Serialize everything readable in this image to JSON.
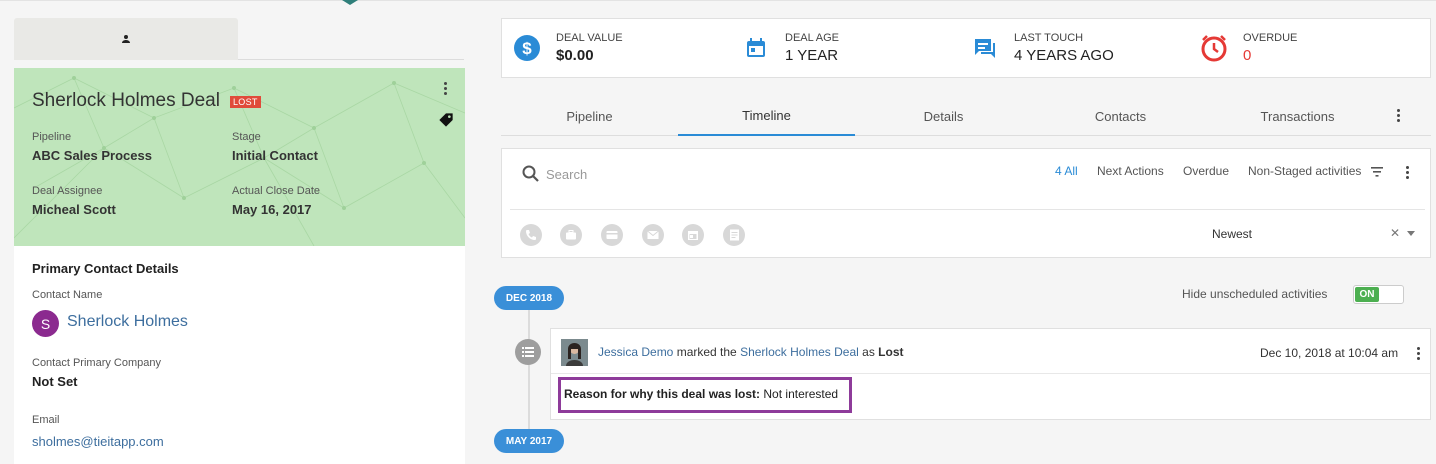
{
  "left_panel": {
    "deal": {
      "title": "Sherlock Holmes Deal",
      "status_badge": "LOST",
      "fields": [
        {
          "label": "Pipeline",
          "value": "ABC Sales Process"
        },
        {
          "label": "Stage",
          "value": "Initial Contact"
        },
        {
          "label": "Deal Assignee",
          "value": "Micheal Scott"
        },
        {
          "label": "Actual Close Date",
          "value": "May 16, 2017"
        }
      ]
    },
    "contact": {
      "section_title": "Primary Contact Details",
      "name_label": "Contact Name",
      "avatar_letter": "S",
      "name": "Sherlock Holmes",
      "company_label": "Contact Primary Company",
      "company": "Not Set",
      "email_label": "Email",
      "email": "sholmes@tieitapp.com"
    }
  },
  "stats": [
    {
      "label": "DEAL VALUE",
      "value": "$0.00",
      "icon": "dollar-icon",
      "color": "#2a8bd6"
    },
    {
      "label": "DEAL AGE",
      "value": "1 YEAR",
      "icon": "calendar-icon",
      "color": "#2a8bd6"
    },
    {
      "label": "LAST TOUCH",
      "value": "4 YEARS AGO",
      "icon": "chat-icon",
      "color": "#2a8bd6"
    },
    {
      "label": "OVERDUE",
      "value": "0",
      "icon": "alarm-icon",
      "color": "#e53935"
    }
  ],
  "tabs": [
    "Pipeline",
    "Timeline",
    "Details",
    "Contacts",
    "Transactions"
  ],
  "active_tab": "Timeline",
  "filters": {
    "search_placeholder": "Search",
    "options": [
      "4 All",
      "Next Actions",
      "Overdue",
      "Non-Staged activities"
    ],
    "active": "4 All",
    "activity_icons": [
      "phone-icon",
      "briefcase-icon",
      "card-icon",
      "mail-icon",
      "calendar-icon",
      "note-icon"
    ],
    "sort": "Newest"
  },
  "timeline": {
    "hide_label": "Hide unscheduled activities",
    "toggle_state": "ON",
    "groups": [
      "DEC 2018",
      "MAY 2017"
    ],
    "entry": {
      "user": "Jessica Demo",
      "action": "marked the",
      "deal": "Sherlock Holmes Deal",
      "as_text": "as",
      "status": "Lost",
      "date": "Dec 10, 2018 at 10:04 am",
      "reason_label": "Reason for why this deal was lost:",
      "reason_value": "Not interested"
    }
  },
  "colors": {
    "accent": "#2a8bd6",
    "lost": "#e04b3a",
    "highlight": "#8e3b9a",
    "card_bg": "#bfe5bb"
  }
}
